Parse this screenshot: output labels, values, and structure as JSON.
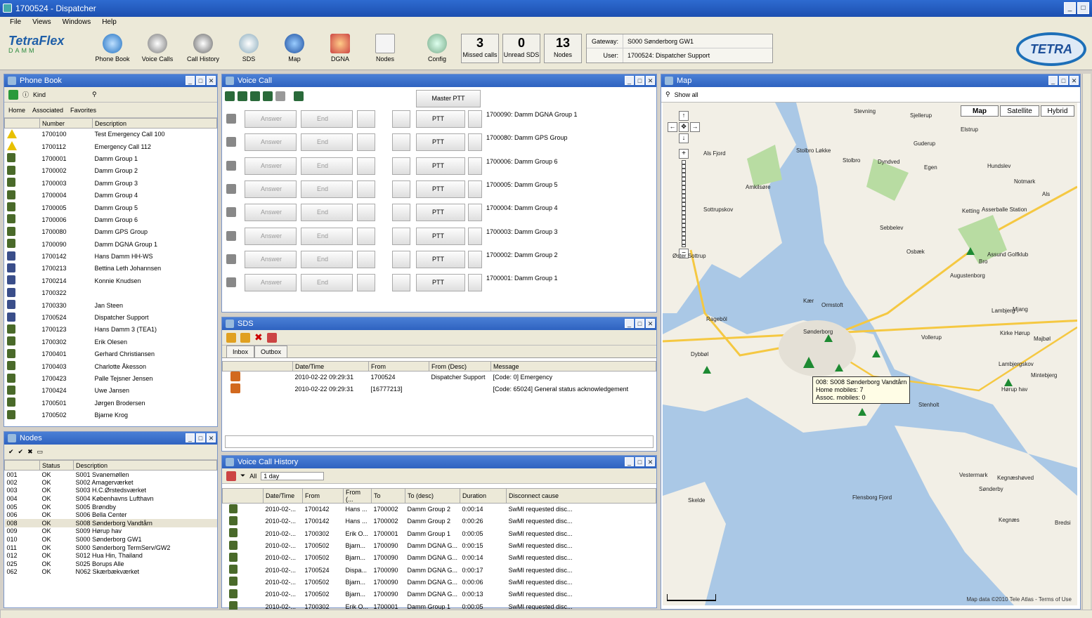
{
  "window": {
    "title": "1700524 - Dispatcher",
    "min": "_",
    "max": "□"
  },
  "menu": [
    "File",
    "Views",
    "Windows",
    "Help"
  ],
  "toolbar": {
    "logo_text": "TetraFlex",
    "logo_sub": "DAMM",
    "buttons": [
      "Phone Book",
      "Voice Calls",
      "Call History",
      "SDS",
      "Map",
      "DGNA",
      "Nodes",
      "Config"
    ],
    "counters": [
      {
        "value": "3",
        "label": "Missed calls"
      },
      {
        "value": "0",
        "label": "Unread SDS"
      },
      {
        "value": "13",
        "label": "Nodes"
      }
    ],
    "gateway_label": "Gateway:",
    "gateway_value": "S000 Sønderborg GW1",
    "user_label": "User:",
    "user_value": "1700524: Dispatcher Support",
    "brand": "TETRA"
  },
  "phonebook": {
    "title": "Phone Book",
    "kind": "Kind",
    "tabs": [
      "Home",
      "Associated",
      "Favorites"
    ],
    "columns": [
      "Number",
      "Description"
    ],
    "rows": [
      {
        "icon": "warning",
        "number": "1700100",
        "desc": "Test Emergency Call 100"
      },
      {
        "icon": "warning",
        "number": "1700112",
        "desc": "Emergency Call 112"
      },
      {
        "icon": "group",
        "number": "1700001",
        "desc": "Damm Group 1"
      },
      {
        "icon": "group",
        "number": "1700002",
        "desc": "Damm Group 2"
      },
      {
        "icon": "group",
        "number": "1700003",
        "desc": "Damm Group 3"
      },
      {
        "icon": "group",
        "number": "1700004",
        "desc": "Damm Group 4"
      },
      {
        "icon": "group",
        "number": "1700005",
        "desc": "Damm Group 5"
      },
      {
        "icon": "group",
        "number": "1700006",
        "desc": "Damm Group 6"
      },
      {
        "icon": "group",
        "number": "1700080",
        "desc": "Damm GPS Group"
      },
      {
        "icon": "group",
        "number": "1700090",
        "desc": "Damm DGNA Group 1"
      },
      {
        "icon": "radio",
        "number": "1700142",
        "desc": "Hans Damm HH-WS"
      },
      {
        "icon": "radio",
        "number": "1700213",
        "desc": "Bettina Leth Johannsen"
      },
      {
        "icon": "radio",
        "number": "1700214",
        "desc": "Konnie Knudsen"
      },
      {
        "icon": "radio",
        "number": "1700322",
        "desc": ""
      },
      {
        "icon": "radio",
        "number": "1700330",
        "desc": "Jan Steen"
      },
      {
        "icon": "radio",
        "number": "1700524",
        "desc": "Dispatcher Support"
      },
      {
        "icon": "handset",
        "number": "1700123",
        "desc": "Hans Damm 3 (TEA1)"
      },
      {
        "icon": "handset",
        "number": "1700302",
        "desc": "Erik Olesen"
      },
      {
        "icon": "handset",
        "number": "1700401",
        "desc": "Gerhard Christiansen"
      },
      {
        "icon": "handset",
        "number": "1700403",
        "desc": "Charlotte Åkesson"
      },
      {
        "icon": "handset",
        "number": "1700423",
        "desc": "Palle Tejsner Jensen"
      },
      {
        "icon": "handset",
        "number": "1700424",
        "desc": "Uwe Jansen"
      },
      {
        "icon": "handset",
        "number": "1700501",
        "desc": "Jørgen Brodersen"
      },
      {
        "icon": "handset",
        "number": "1700502",
        "desc": "Bjarne Krog"
      }
    ]
  },
  "nodes": {
    "title": "Nodes",
    "columns": [
      "Status",
      "Description"
    ],
    "rows": [
      {
        "id": "001",
        "status": "OK",
        "desc": "S001 Svanemøllen"
      },
      {
        "id": "002",
        "status": "OK",
        "desc": "S002 Amagerværket"
      },
      {
        "id": "003",
        "status": "OK",
        "desc": "S003 H.C.Ørstedsværket"
      },
      {
        "id": "004",
        "status": "OK",
        "desc": "S004 Københavns Lufthavn"
      },
      {
        "id": "005",
        "status": "OK",
        "desc": "S005 Brøndby"
      },
      {
        "id": "006",
        "status": "OK",
        "desc": "S006 Bella Center"
      },
      {
        "id": "008",
        "status": "OK",
        "desc": "S008 Sønderborg Vandtårn"
      },
      {
        "id": "009",
        "status": "OK",
        "desc": "S009 Hørup hav"
      },
      {
        "id": "010",
        "status": "OK",
        "desc": "S000 Sønderborg GW1"
      },
      {
        "id": "011",
        "status": "OK",
        "desc": "S000 Sønderborg TermServ/GW2"
      },
      {
        "id": "012",
        "status": "OK",
        "desc": "S012 Hua Hin, Thailand"
      },
      {
        "id": "025",
        "status": "OK",
        "desc": "S025 Borups Alle"
      },
      {
        "id": "062",
        "status": "OK",
        "desc": "N062 Skærbækværket"
      }
    ]
  },
  "voicecall": {
    "title": "Voice Call",
    "master": "Master PTT",
    "answer": "Answer",
    "end": "End",
    "ptt": "PTT",
    "groups": [
      "1700090:  Damm DGNA Group 1",
      "1700080:  Damm GPS Group",
      "1700006:  Damm Group 6",
      "1700005:  Damm Group 5",
      "1700004:  Damm Group 4",
      "1700003:  Damm Group 3",
      "1700002:  Damm Group 2",
      "1700001:  Damm Group 1"
    ]
  },
  "sds": {
    "title": "SDS",
    "tabs": [
      "Inbox",
      "Outbox"
    ],
    "columns": [
      "Date/Time",
      "From",
      "From (Desc)",
      "Message"
    ],
    "rows": [
      {
        "time": "2010-02-22  09:29:31",
        "from": "1700524",
        "fromdesc": "Dispatcher Support",
        "msg": "[Code: 0] Emergency"
      },
      {
        "time": "2010-02-22  09:29:31",
        "from": "[16777213]",
        "fromdesc": "",
        "msg": "[Code: 65024] General status acknowledgement"
      }
    ]
  },
  "history": {
    "title": "Voice Call History",
    "filter": "All",
    "period": "1 day",
    "columns": [
      "Date/Time",
      "From",
      "From (...",
      "To",
      "To (desc)",
      "Duration",
      "Disconnect cause"
    ],
    "rows": [
      {
        "t": "2010-02-...",
        "f": "1700142",
        "fd": "Hans ...",
        "to": "1700002",
        "td": "Damm Group 2",
        "d": "0:00:14",
        "c": "SwMI requested disc..."
      },
      {
        "t": "2010-02-...",
        "f": "1700142",
        "fd": "Hans ...",
        "to": "1700002",
        "td": "Damm Group 2",
        "d": "0:00:26",
        "c": "SwMI requested disc..."
      },
      {
        "t": "2010-02-...",
        "f": "1700302",
        "fd": "Erik O...",
        "to": "1700001",
        "td": "Damm Group 1",
        "d": "0:00:05",
        "c": "SwMI requested disc..."
      },
      {
        "t": "2010-02-...",
        "f": "1700502",
        "fd": "Bjarn...",
        "to": "1700090",
        "td": "Damm DGNA G...",
        "d": "0:00:15",
        "c": "SwMI requested disc..."
      },
      {
        "t": "2010-02-...",
        "f": "1700502",
        "fd": "Bjarn...",
        "to": "1700090",
        "td": "Damm DGNA G...",
        "d": "0:00:14",
        "c": "SwMI requested disc..."
      },
      {
        "t": "2010-02-...",
        "f": "1700524",
        "fd": "Dispa...",
        "to": "1700090",
        "td": "Damm DGNA G...",
        "d": "0:00:17",
        "c": "SwMI requested disc..."
      },
      {
        "t": "2010-02-...",
        "f": "1700502",
        "fd": "Bjarn...",
        "to": "1700090",
        "td": "Damm DGNA G...",
        "d": "0:00:06",
        "c": "SwMI requested disc..."
      },
      {
        "t": "2010-02-...",
        "f": "1700502",
        "fd": "Bjarn...",
        "to": "1700090",
        "td": "Damm DGNA G...",
        "d": "0:00:13",
        "c": "SwMI requested disc..."
      },
      {
        "t": "2010-02-...",
        "f": "1700302",
        "fd": "Erik O...",
        "to": "1700001",
        "td": "Damm Group 1",
        "d": "0:00:05",
        "c": "SwMI requested disc..."
      }
    ]
  },
  "map": {
    "title": "Map",
    "showall": "Show all",
    "types": [
      "Map",
      "Satellite",
      "Hybrid"
    ],
    "places": [
      "Stevning",
      "Sjellerup",
      "Elstrup",
      "Guderup",
      "Stolbro Løkke",
      "Stolbro",
      "Dyndved",
      "Egen",
      "Hundslev",
      "Notmark",
      "Als Fjord",
      "Amkilsøre",
      "Sottrupskov",
      "Ketting",
      "Asserballe Station",
      "Sebbelev",
      "Als",
      "Osbæk",
      "Bro",
      "Assund Golfklub",
      "Augustenborg",
      "Øster Sottrup",
      "Kær",
      "Ormstoft",
      "Lambjerg",
      "Mjang",
      "Rageböl",
      "Sønderborg",
      "Dybbøl",
      "Kirke Hørup",
      "Majbøl",
      "Vollerup",
      "Lambjergskov",
      "Hørup hav",
      "Mintebjerg",
      "Stenholt",
      "Vestermark",
      "Kegnæshøved",
      "Sønderby",
      "Kegnæs",
      "Skelde",
      "Flensborg Fjord",
      "Bredsi"
    ],
    "tooltip": [
      "008: S008 Sønderborg Vandtårn",
      "Home mobiles: 7",
      "Assoc. mobiles: 0"
    ],
    "copyright": "Map data ©2010 Tele Atlas - Terms of Use"
  }
}
